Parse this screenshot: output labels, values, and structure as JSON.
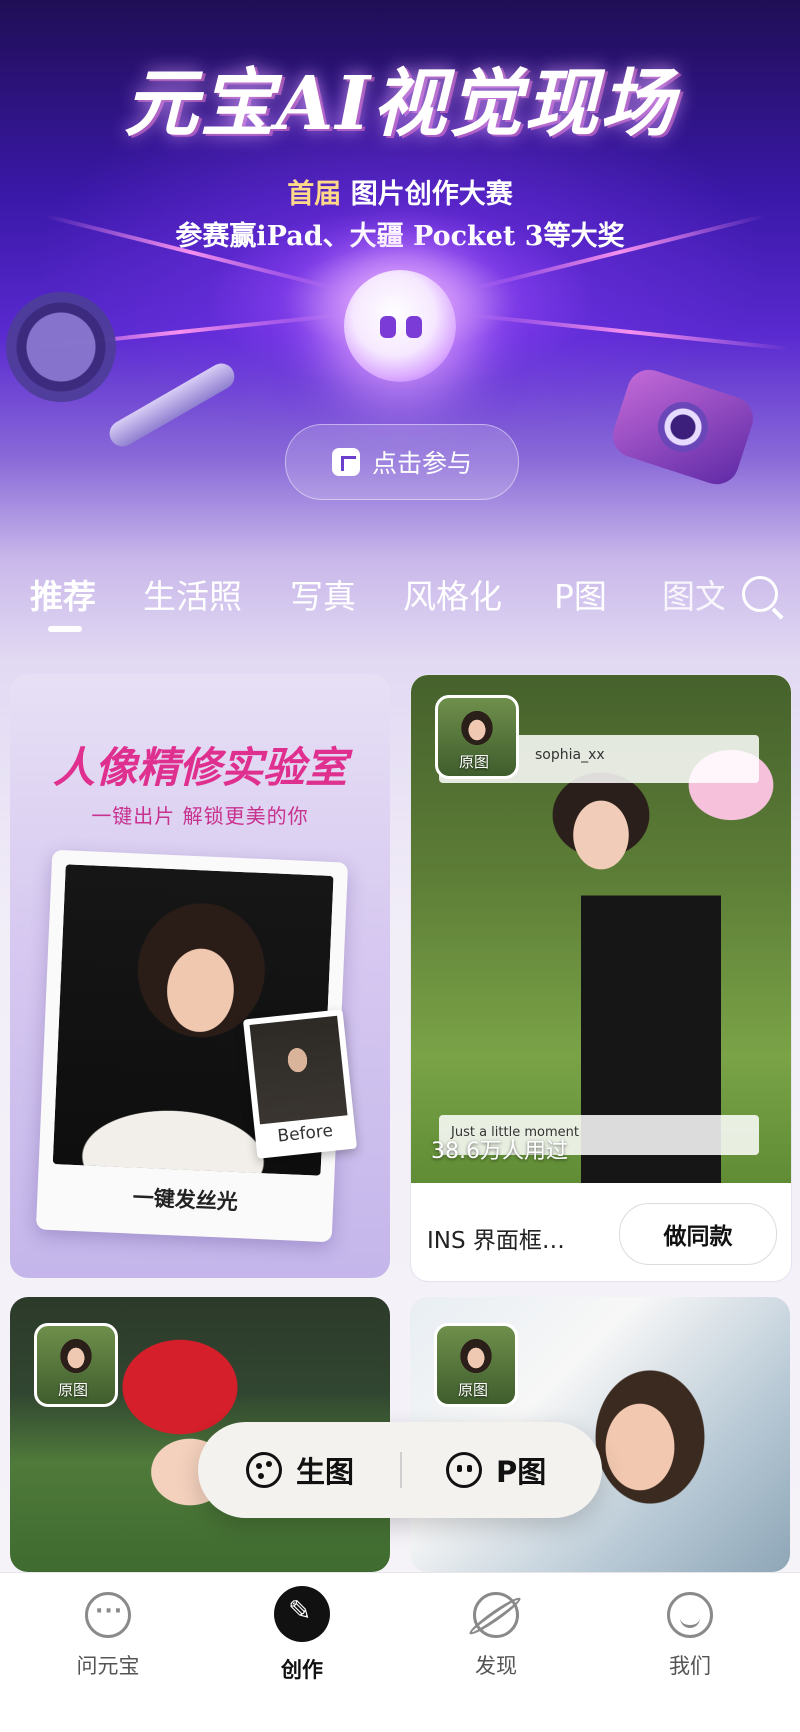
{
  "banner": {
    "title": "元宝AI视觉现场",
    "subtitle_highlight": "首届",
    "subtitle_rest": "图片创作大赛",
    "prize_text": "参赛赢iPad、大疆 Pocket 3等大奖",
    "join_label": "点击参与"
  },
  "tabs": [
    {
      "label": "推荐",
      "active": true
    },
    {
      "label": "生活照",
      "active": false
    },
    {
      "label": "写真",
      "active": false
    },
    {
      "label": "风格化",
      "active": false
    },
    {
      "label": "P图",
      "active": false
    },
    {
      "label": "图文",
      "active": false
    }
  ],
  "feed": {
    "card1": {
      "title": "人像精修实验室",
      "subtitle": "一键出片  解锁更美的你",
      "caption": "一键发丝光",
      "before_label": "Before"
    },
    "card2": {
      "original_label": "原图",
      "frame_handle": "sophia_xx",
      "frame_caption": "Just a little moment",
      "used_count": "38.6万人用过",
      "name": "INS 界面框…",
      "same_button": "做同款"
    },
    "card3": {
      "original_label": "原图"
    },
    "card4": {
      "original_label": "原图"
    }
  },
  "fab": {
    "generate_label": "生图",
    "edit_label": "P图"
  },
  "bottom_nav": [
    {
      "label": "问元宝",
      "icon": "chat-icon",
      "active": false
    },
    {
      "label": "创作",
      "icon": "create-icon",
      "active": true
    },
    {
      "label": "发现",
      "icon": "planet-icon",
      "active": false
    },
    {
      "label": "我们",
      "icon": "profile-icon",
      "active": false
    }
  ],
  "colors": {
    "banner_purple": "#3a18a8",
    "card_title_pink": "#e0308f",
    "text_dark": "#111111"
  }
}
